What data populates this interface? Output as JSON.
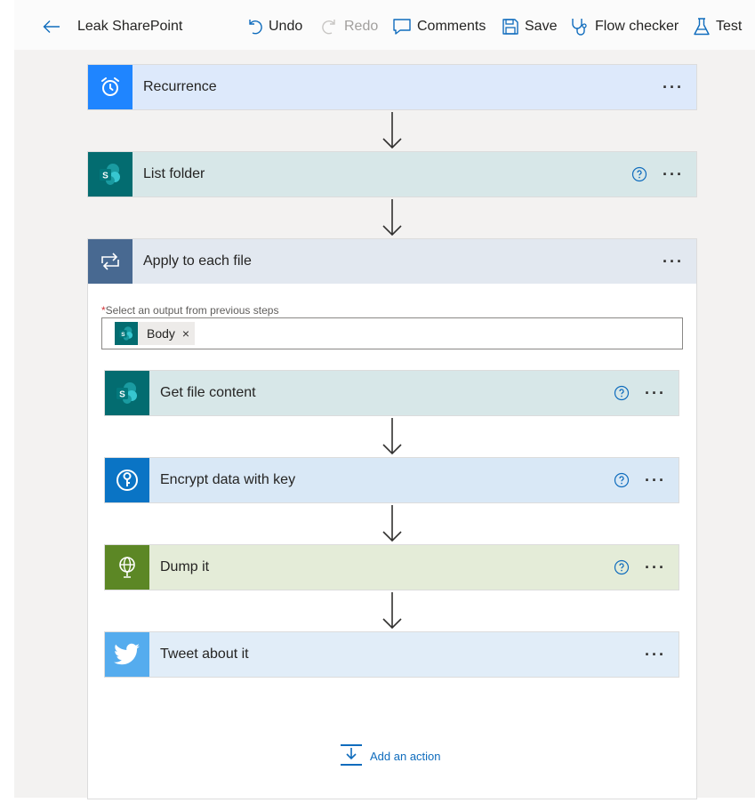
{
  "toolbar": {
    "back_icon": "arrow-left-icon",
    "flow_name": "Leak SharePoint",
    "undo": "Undo",
    "redo": "Redo",
    "comments": "Comments",
    "save": "Save",
    "flow_checker": "Flow checker",
    "test": "Test"
  },
  "steps": {
    "recurrence": {
      "title": "Recurrence",
      "icon": "alarm-clock-icon",
      "color": "#1f85ff",
      "bg": "#dde9fb"
    },
    "list_folder": {
      "title": "List folder",
      "icon": "sharepoint-icon",
      "color": "#036c70",
      "bg": "#d7e7e8"
    },
    "apply_each": {
      "title": "Apply to each file",
      "icon": "loop-icon",
      "color": "#486991",
      "bg": "#e2e8f0"
    },
    "get_file": {
      "title": "Get file content",
      "icon": "sharepoint-icon",
      "color": "#036c70",
      "bg": "#d7e7e8"
    },
    "encrypt": {
      "title": "Encrypt data with key",
      "icon": "encryption-icon",
      "color": "#0a74c5",
      "bg": "#d9e8f6"
    },
    "dump": {
      "title": "Dump it",
      "icon": "globe-icon",
      "color": "#5c8725",
      "bg": "#e4ecd8"
    },
    "tweet": {
      "title": "Tweet about it",
      "icon": "twitter-icon",
      "color": "#55acee",
      "bg": "#e1edf8"
    }
  },
  "apply_each_input": {
    "required_mark": "*",
    "label": "Select an output from previous steps",
    "token": "Body",
    "token_remove": "×"
  },
  "more_label": "···",
  "add_action": "Add an action"
}
